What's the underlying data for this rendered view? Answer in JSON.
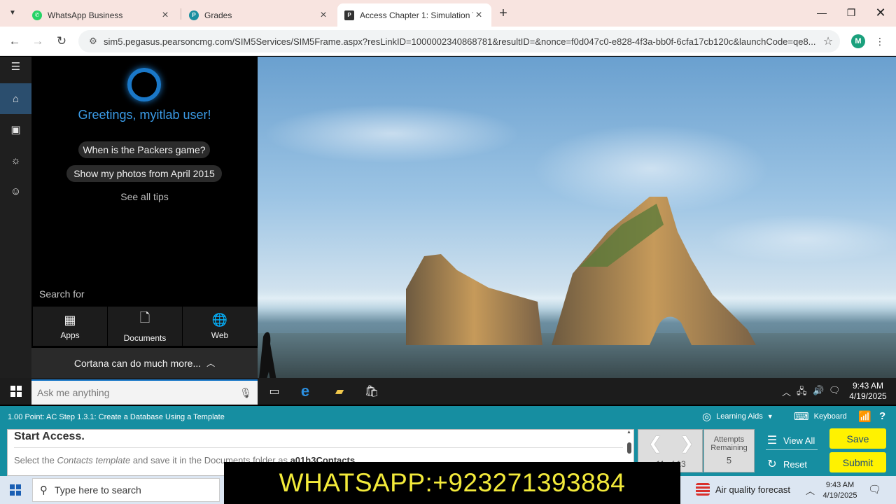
{
  "browser": {
    "tabs": [
      {
        "title": "WhatsApp Business",
        "active": false
      },
      {
        "title": "Grades",
        "active": false
      },
      {
        "title": "Access Chapter 1: Simulation Tr",
        "active": true
      }
    ],
    "url": "sim5.pegasus.pearsoncmg.com/SIM5Services/SIM5Frame.aspx?resLinkID=1000002340868781&resultID=&nonce=f0d047c0-e828-4f3a-bb0f-6cfa17cb120c&launchCode=qe8...",
    "profile_initial": "M"
  },
  "cortana": {
    "greeting": "Greetings, myitlab user!",
    "suggestions": [
      "When is the Packers game?",
      "Show my photos from April 2015"
    ],
    "see_all_tips": "See all tips",
    "search_for_label": "Search for",
    "categories": [
      "Apps",
      "Documents",
      "Web"
    ],
    "more_label": "Cortana can do much more..."
  },
  "inner_taskbar": {
    "search_placeholder": "Ask me anything",
    "time": "9:43 AM",
    "date": "4/19/2025"
  },
  "simulation": {
    "task_title": "1.00 Point: AC Step 1.3.1: Create a Database Using a Template",
    "learning_aids": "Learning Aids",
    "keyboard": "Keyboard",
    "help": "?",
    "instruction_heading": "Start Access.",
    "instruction_pre": "Select the ",
    "instruction_italic": "Contacts template",
    "instruction_mid": " and save it in the Documents folder as ",
    "instruction_bold": "a01h3Contacts",
    "instruction_end": ".",
    "step_counter": "11 of 13",
    "attempts_label": "Attempts Remaining",
    "attempts_value": "5",
    "view_all": "View All",
    "reset": "Reset",
    "save": "Save",
    "submit": "Submit"
  },
  "windows_taskbar": {
    "search_placeholder": "Type here to search",
    "banner": "WHATSAPP:+923271393884",
    "weather": "Air quality forecast",
    "time": "9:43 AM",
    "date": "4/19/2025"
  },
  "colors": {
    "tabstrip": "#f8e4e0",
    "cortana_blue": "#1a78c8",
    "sim_teal": "#168ea1",
    "button_yellow": "#fff200",
    "banner_text": "#f3ea3a"
  }
}
